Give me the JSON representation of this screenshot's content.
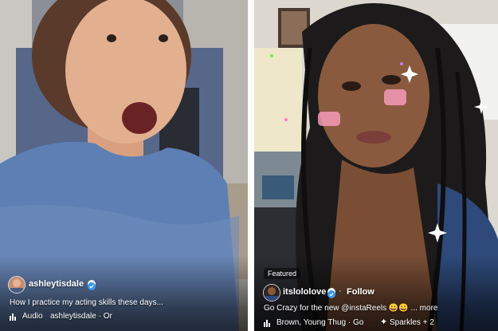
{
  "left_reel": {
    "username": "ashleytisdale",
    "caption": "How I practice my acting skills these days...",
    "audio_label": "Audio",
    "audio_source": "ashleytisdale · Or"
  },
  "right_reel": {
    "featured_badge": "Featured",
    "username": "itslololove",
    "follow_label": "Follow",
    "caption": "Go Crazy for the new @instaReels 😀😀 ... more",
    "audio_track": "Brown, Young Thug · Go",
    "effect_label": "Sparkles + 2"
  },
  "colors": {
    "overlay_text": "#ffffff",
    "verified_badge": "#3897f0"
  }
}
